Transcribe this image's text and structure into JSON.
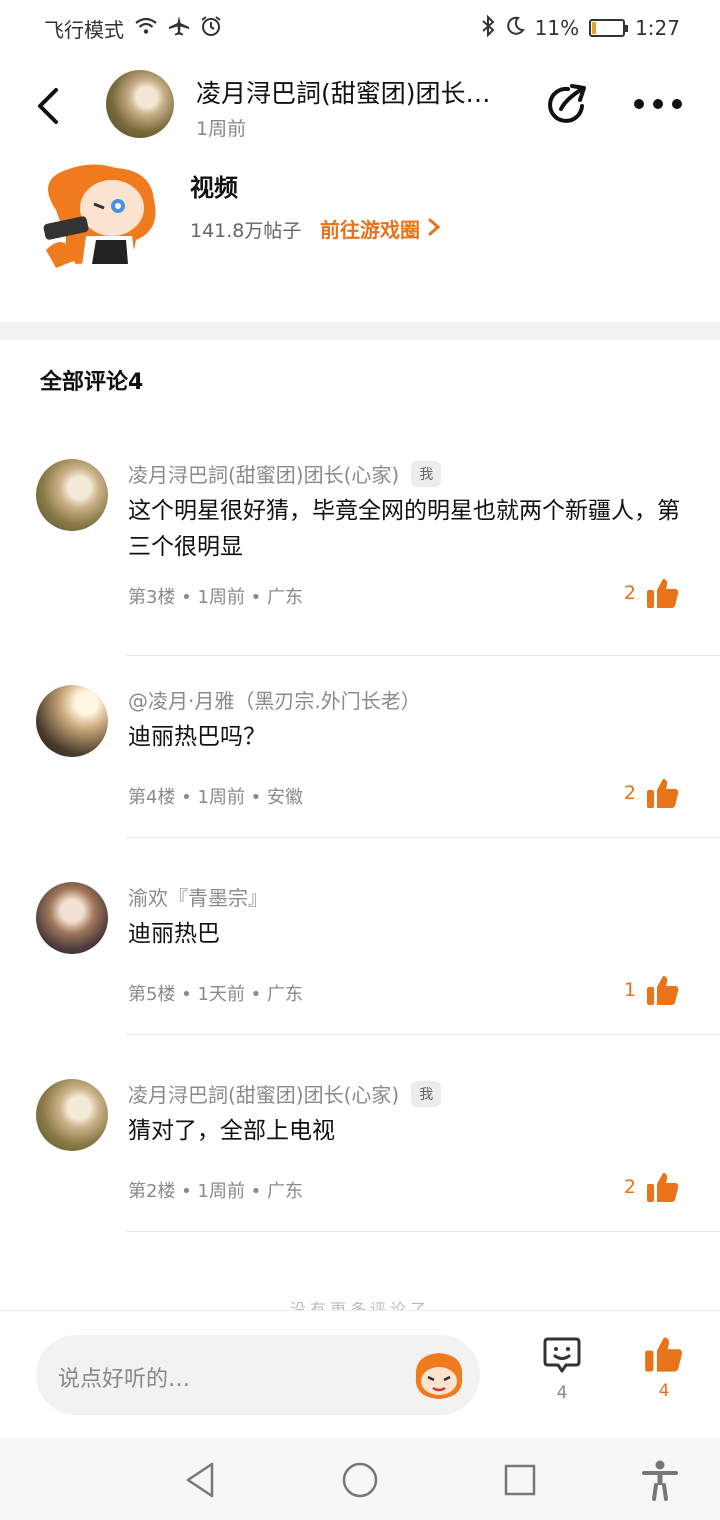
{
  "status_bar": {
    "mode": "飞行模式",
    "battery": "11%",
    "battery_level": 0.11,
    "time": "1:27"
  },
  "header": {
    "title": "凌月浔巴詞(甜蜜团)团长…",
    "time": "1周前"
  },
  "game": {
    "name": "视频",
    "stats": "141.8万帖子",
    "link": "前往游戏圈"
  },
  "comments_section": {
    "title": "全部评论4"
  },
  "comments": [
    {
      "name": "凌月浔巴詞(甜蜜团)团长(心家)",
      "badge": "我",
      "text": "这个明星很好猜，毕竟全网的明星也就两个新疆人，第三个很明显",
      "meta": "第3楼 • 1周前 • 广东",
      "likes": "2"
    },
    {
      "name": "@凌月·月雅（黑刃宗.外门长老）",
      "badge": "",
      "text": "迪丽热巴吗？",
      "meta": "第4楼 • 1周前 • 安徽",
      "likes": "2"
    },
    {
      "name": "渝欢『青墨宗』",
      "badge": "",
      "text": "迪丽热巴",
      "meta": "第5楼 • 1天前 • 广东",
      "likes": "1"
    },
    {
      "name": "凌月浔巴詞(甜蜜团)团长(心家)",
      "badge": "我",
      "text": "猜对了，全部上电视",
      "meta": "第2楼 • 1周前 • 广东",
      "likes": "2"
    }
  ],
  "footer_hint": "没有更多评论了",
  "bottom_bar": {
    "placeholder": "说点好听的…",
    "comment_count": "4",
    "like_count": "4"
  },
  "colors": {
    "accent": "#e8731a",
    "divider": "#f2f2f2"
  }
}
